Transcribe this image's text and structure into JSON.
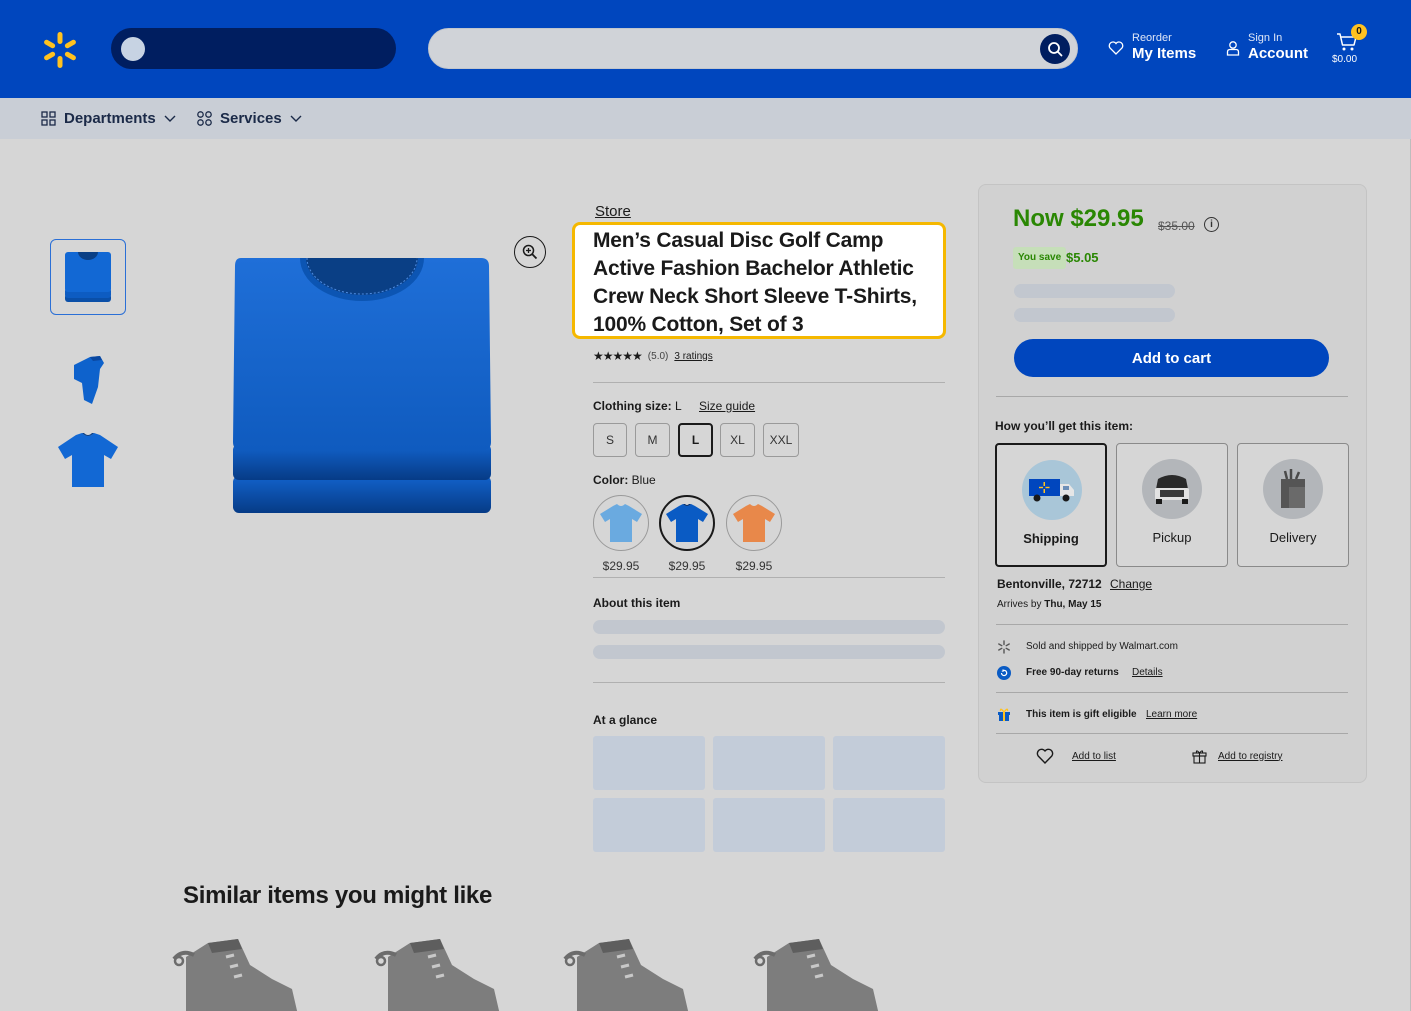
{
  "header": {
    "reorder_small": "Reorder",
    "reorder_big": "My Items",
    "signin_small": "Sign In",
    "signin_big": "Account",
    "cart_count": "0",
    "cart_total": "$0.00"
  },
  "subnav": {
    "departments": "Departments",
    "services": "Services"
  },
  "product": {
    "store": "Store",
    "title": "Men’s Casual Disc Golf Camp Active Fashion Bachelor Athletic Crew Neck Short Sleeve T-Shirts, 100% Cotton,  Set of 3",
    "rating_value": "(5.0)",
    "rating_count": "3 ratings",
    "size_label": "Clothing size:",
    "size_value": "L",
    "size_guide": "Size guide",
    "sizes": [
      "S",
      "M",
      "L",
      "XL",
      "XXL"
    ],
    "selected_size": "L",
    "color_label": "Color:",
    "color_value": "Blue",
    "colors": [
      {
        "name": "Light blue",
        "hex": "#6aaae0",
        "price": "$29.95"
      },
      {
        "name": "Blue",
        "hex": "#0a5bc4",
        "price": "$29.95"
      },
      {
        "name": "Orange",
        "hex": "#e8884a",
        "price": "$29.95"
      }
    ],
    "about_heading": "About this item",
    "glance_heading": "At a glance"
  },
  "similar": {
    "heading": "Similar items you might like"
  },
  "buybox": {
    "price_now": "Now $29.95",
    "price_was": "$35.00",
    "info_icon": "i",
    "you_save_label": "You save",
    "you_save_amount": "$5.05",
    "add_to_cart": "Add to cart",
    "fulfillment_heading": "How you’ll get this item:",
    "options": [
      "Shipping",
      "Pickup",
      "Delivery"
    ],
    "selected_option": "Shipping",
    "location": "Bentonville, 72712",
    "change": "Change",
    "arrives_prefix": "Arrives by",
    "arrives_date": "Thu, May 15",
    "sold_by": "Sold and shipped by Walmart.com",
    "returns": "Free 90-day returns",
    "returns_details": "Details",
    "gift": "This item is gift eligible",
    "gift_learn": "Learn more",
    "add_to_list": "Add to list",
    "add_to_registry": "Add to registry"
  },
  "colors": {
    "brand_blue": "#0046be",
    "brand_navy": "#001e60",
    "spark_yellow": "#ffc220",
    "price_green": "#2a8703",
    "highlight": "#f5b800"
  }
}
